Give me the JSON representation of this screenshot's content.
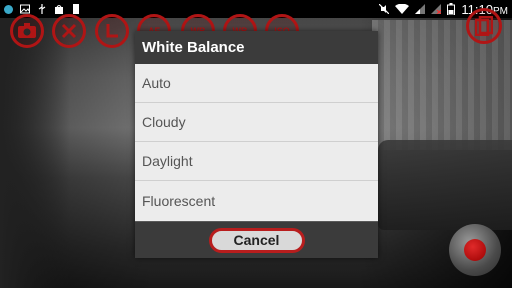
{
  "statusbar": {
    "left_icons": [
      "notification-dot-icon",
      "image-icon",
      "usb-icon",
      "shopping-bag-icon",
      "sd-card-icon"
    ],
    "right_icons": [
      "mute-icon",
      "wifi-icon",
      "signal-icon",
      "signal-off-icon",
      "battery-icon"
    ],
    "time": "11:10",
    "ampm": "PM"
  },
  "camera": {
    "accent_color": "#b01515",
    "top_controls": [
      "switch-camera-icon",
      "flash-off-icon",
      "timer-icon",
      "af",
      "wb",
      "wb",
      "iso",
      "gallery-icon"
    ],
    "labels": {
      "af": "AF",
      "wb1": "WB",
      "wb2": "WB",
      "iso": "ISO"
    }
  },
  "dialog": {
    "title": "White Balance",
    "options": [
      "Auto",
      "Cloudy",
      "Daylight",
      "Fluorescent"
    ],
    "cancel_label": "Cancel"
  }
}
